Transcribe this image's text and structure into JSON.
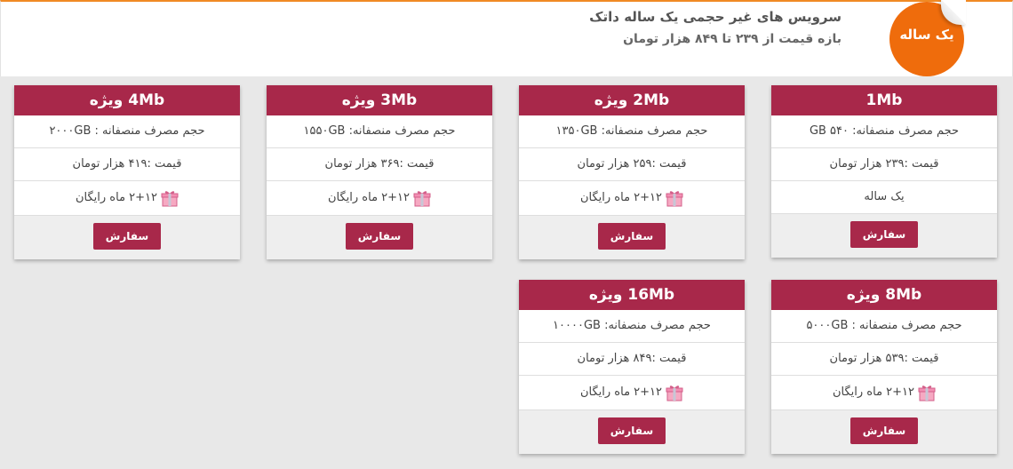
{
  "header": {
    "sticker_label": "یک ساله",
    "title": "سرویس های غیر حجمی یک ساله داتک",
    "subtitle": "بازه قیمت از ۲۳۹ تا ۸۴۹ هزار تومان"
  },
  "cards": [
    {
      "title": "1Mb",
      "volume": "حجم مصرف منصفانه: GB ۵۴۰",
      "price": "قیمت :۲۳۹ هزار تومان",
      "extra": "یک ساله",
      "button": "سفارش"
    },
    {
      "title": "2Mb ویژه",
      "volume": "حجم مصرف منصفانه: ۱۳۵۰GB",
      "price": "قیمت :۲۵۹ هزار تومان",
      "extra": "۲+۱۲ ماه رایگان",
      "button": "سفارش"
    },
    {
      "title": "3Mb ویژه",
      "volume": "حجم مصرف منصفانه: ۱۵۵۰GB",
      "price": "قیمت :۳۶۹ هزار تومان",
      "extra": "۲+۱۲ ماه رایگان",
      "button": "سفارش"
    },
    {
      "title": "4Mb ویژه",
      "volume": "حجم مصرف منصفانه : ۲۰۰۰GB",
      "price": "قیمت :۴۱۹ هزار تومان",
      "extra": "۲+۱۲ ماه رایگان",
      "button": "سفارش"
    },
    {
      "title": "8Mb ویژه",
      "volume": "حجم مصرف منصفانه : ۵۰۰۰GB",
      "price": "قیمت :۵۳۹ هزار تومان",
      "extra": "۲+۱۲ ماه رایگان",
      "button": "سفارش"
    },
    {
      "title": "16Mb ویژه",
      "volume": "حجم مصرف منصفانه: ۱۰۰۰۰GB",
      "price": "قیمت :۸۴۹ هزار تومان",
      "extra": "۲+۱۲ ماه رایگان",
      "button": "سفارش"
    }
  ],
  "icons": {
    "gift": "gift-icon",
    "sticker": "sticker-badge"
  },
  "colors": {
    "accent": "#a8284a",
    "sticker": "#ef6c0c",
    "header_border": "#f08a24"
  }
}
